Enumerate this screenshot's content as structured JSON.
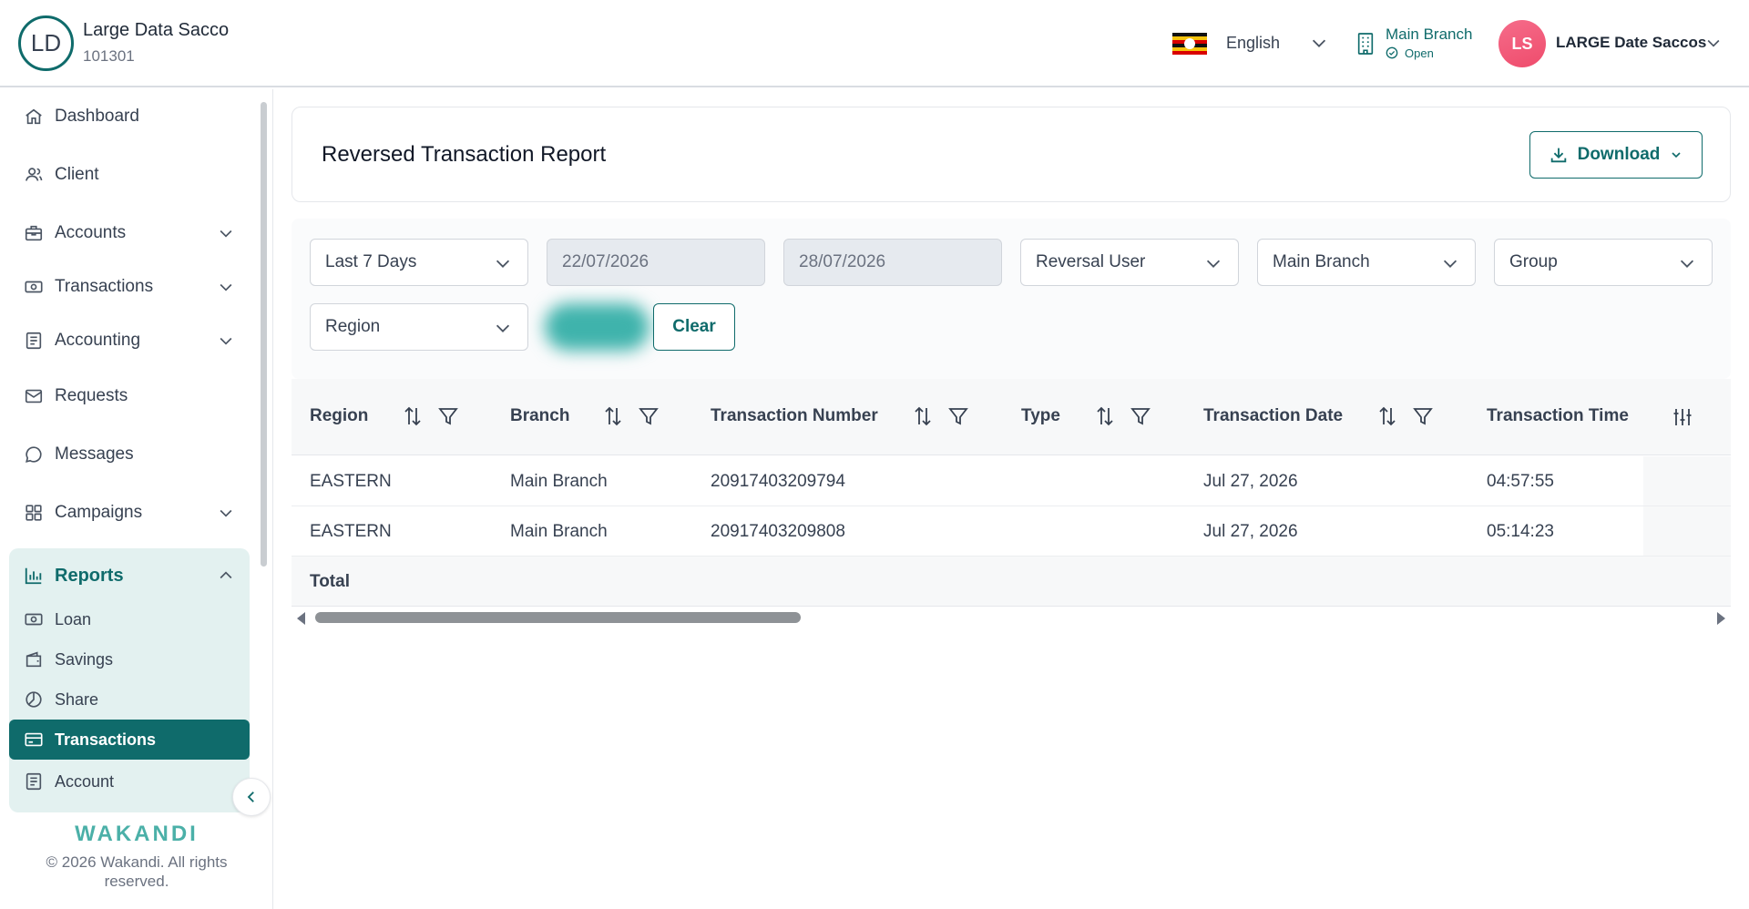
{
  "header": {
    "org_initials": "LD",
    "org_name": "Large Data Sacco",
    "org_code": "101301",
    "language": "English",
    "branch_name": "Main Branch",
    "branch_status": "Open",
    "user_initials": "LS",
    "user_name": "LARGE Date Saccos",
    "colors": {
      "brand": "#0f6b6b",
      "avatar": "#ef4c6c"
    }
  },
  "sidebar": {
    "items": [
      {
        "label": "Dashboard",
        "icon": "home-icon",
        "expandable": false
      },
      {
        "label": "Client",
        "icon": "users-icon",
        "expandable": false
      },
      {
        "label": "Accounts",
        "icon": "briefcase-icon",
        "expandable": true
      },
      {
        "label": "Transactions",
        "icon": "money-icon",
        "expandable": true
      },
      {
        "label": "Accounting",
        "icon": "ledger-icon",
        "expandable": true
      },
      {
        "label": "Requests",
        "icon": "mail-icon",
        "expandable": false
      },
      {
        "label": "Messages",
        "icon": "chat-icon",
        "expandable": false
      },
      {
        "label": "Campaigns",
        "icon": "grid-icon",
        "expandable": true
      }
    ],
    "reports": {
      "label": "Reports",
      "children": [
        {
          "label": "Loan",
          "icon": "money-icon",
          "active": false
        },
        {
          "label": "Savings",
          "icon": "wallet-icon",
          "active": false
        },
        {
          "label": "Share",
          "icon": "pie-icon",
          "active": false
        },
        {
          "label": "Transactions",
          "icon": "card-icon",
          "active": true
        },
        {
          "label": "Account",
          "icon": "ledger-icon",
          "active": false
        }
      ]
    },
    "brand": "WAKANDI",
    "copyright": "© 2026 Wakandi. All rights reserved."
  },
  "page": {
    "title": "Reversed Transaction Report",
    "download_label": "Download"
  },
  "filters": {
    "period": "Last 7 Days",
    "date_from": "22/07/2026",
    "date_to": "28/07/2026",
    "reversal_user": "Reversal User",
    "branch": "Main Branch",
    "group": "Group",
    "region": "Region",
    "clear_label": "Clear"
  },
  "table": {
    "columns": [
      "Region",
      "Branch",
      "Transaction Number",
      "Type",
      "Transaction Date",
      "Transaction Time"
    ],
    "rows": [
      [
        "EASTERN",
        "Main Branch",
        "20917403209794",
        "",
        "Jul 27, 2026",
        "04:57:55"
      ],
      [
        "EASTERN",
        "Main Branch",
        "20917403209808",
        "",
        "Jul 27, 2026",
        "05:14:23"
      ]
    ],
    "total_label": "Total"
  }
}
